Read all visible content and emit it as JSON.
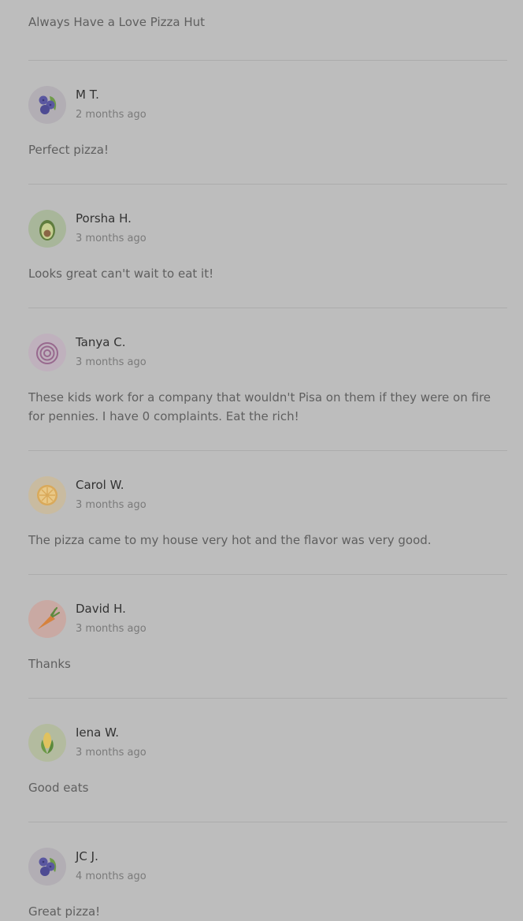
{
  "top_review": {
    "text": "Always Have a Love Pizza Hut"
  },
  "reviews": [
    {
      "name": "M T.",
      "time": "2 months ago",
      "text": "Perfect pizza!",
      "avatar_icon": "blueberry-icon"
    },
    {
      "name": "Porsha H.",
      "time": "3 months ago",
      "text": "Looks great can't wait to eat it!",
      "avatar_icon": "avocado-icon"
    },
    {
      "name": "Tanya C.",
      "time": "3 months ago",
      "text": "These kids work for a company that wouldn't Pisa on them if they were on fire for pennies. I have 0 complaints. Eat the rich!",
      "avatar_icon": "onion-icon"
    },
    {
      "name": "Carol W.",
      "time": "3 months ago",
      "text": "The pizza came to my house very hot and the flavor was very good.",
      "avatar_icon": "orange-slice-icon"
    },
    {
      "name": "David H.",
      "time": "3 months ago",
      "text": "Thanks",
      "avatar_icon": "carrot-icon"
    },
    {
      "name": "Iena W.",
      "time": "3 months ago",
      "text": "Good eats",
      "avatar_icon": "corn-icon"
    },
    {
      "name": "JC J.",
      "time": "4 months ago",
      "text": "Great pizza!",
      "avatar_icon": "blueberry-icon"
    }
  ],
  "colors": {
    "background": "#bdbdbd",
    "divider": "#acacac",
    "name_text": "#333333",
    "meta_text": "#7a7a7a",
    "body_text": "#5f5f5f"
  }
}
